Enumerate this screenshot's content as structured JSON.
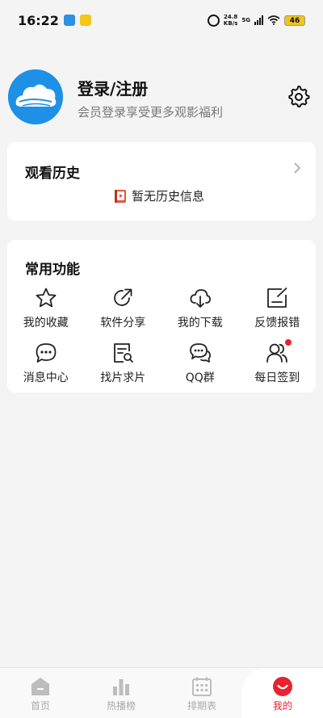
{
  "status": {
    "time": "16:22",
    "net_speed_value": "24.8",
    "net_speed_unit": "KB/s",
    "network": "5G",
    "battery": "46"
  },
  "profile": {
    "title": "登录/注册",
    "subtitle": "会员登录享受更多观影福利",
    "avatar_icon": "cloud-logo-icon",
    "settings_icon": "gear-icon"
  },
  "history": {
    "title": "观看历史",
    "empty_text": "暂无历史信息"
  },
  "features": {
    "title": "常用功能",
    "items": [
      {
        "label": "我的收藏",
        "icon": "star-icon"
      },
      {
        "label": "软件分享",
        "icon": "share-icon"
      },
      {
        "label": "我的下载",
        "icon": "cloud-download-icon"
      },
      {
        "label": "反馈报错",
        "icon": "feedback-icon"
      },
      {
        "label": "消息中心",
        "icon": "message-icon"
      },
      {
        "label": "找片求片",
        "icon": "search-document-icon"
      },
      {
        "label": "QQ群",
        "icon": "chat-group-icon"
      },
      {
        "label": "每日签到",
        "icon": "users-icon"
      }
    ]
  },
  "nav": {
    "items": [
      {
        "label": "首页",
        "icon": "home-icon"
      },
      {
        "label": "热播榜",
        "icon": "bar-chart-icon"
      },
      {
        "label": "排期表",
        "icon": "calendar-icon"
      },
      {
        "label": "我的",
        "icon": "smile-icon"
      }
    ],
    "active_color": "#e8222e",
    "inactive_color": "#aaaaaa"
  }
}
